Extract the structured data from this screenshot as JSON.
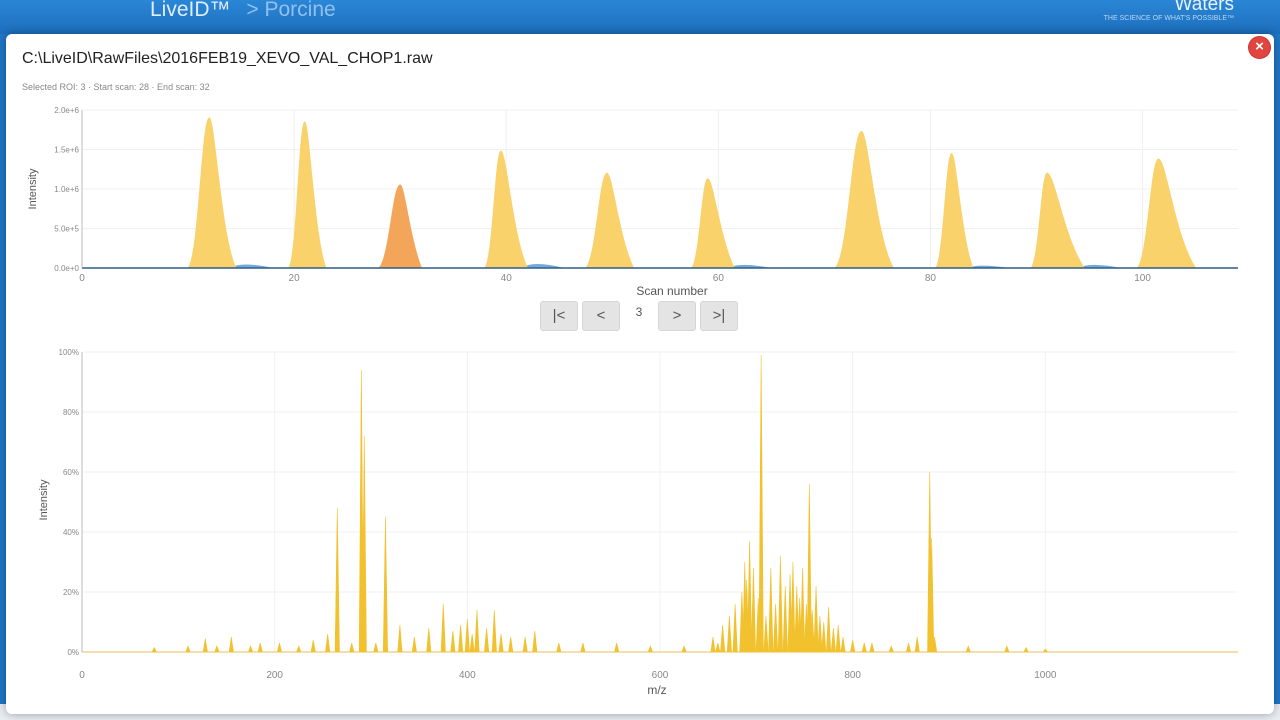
{
  "app": {
    "title": "LiveID™",
    "breadcrumb": "> Porcine",
    "brand": "Waters",
    "brand_sub": "THE SCIENCE OF WHAT'S POSSIBLE™"
  },
  "modal": {
    "file_path": "C:\\LiveID\\RawFiles\\2016FEB19_XEVO_VAL_CHOP1.raw",
    "selection_info": "Selected ROI: 3 · Start scan: 28 · End scan: 32",
    "close_label": "×"
  },
  "pager": {
    "first_label": "|<",
    "prev_label": "<",
    "value": "3",
    "next_label": ">",
    "last_label": ">|"
  },
  "colors": {
    "header": "#1f78c8",
    "peak": "#f9d26b",
    "selected_peak": "#f3a65a",
    "baseline": "#5b9bd5",
    "spectrum": "#f2c12e",
    "close": "#e0463f"
  },
  "chart_data": [
    {
      "type": "area",
      "xlabel": "Scan number",
      "ylabel": "Intensity",
      "xlim": [
        0,
        109
      ],
      "ylim": [
        0,
        2000000.0
      ],
      "x_ticks": [
        0,
        20,
        40,
        60,
        80,
        100
      ],
      "y_tick_labels": [
        "0.0e+0",
        "5.0e+5",
        "1.0e+6",
        "1.5e+6",
        "2.0e+6"
      ],
      "y_ticks": [
        0,
        500000,
        1000000,
        1500000,
        2000000
      ],
      "selected_roi": 3,
      "peaks": [
        {
          "roi": 1,
          "center": 12,
          "start": 10,
          "end": 14.5,
          "height": 1900000.0
        },
        {
          "roi": 2,
          "center": 21,
          "start": 19.5,
          "end": 23,
          "height": 1850000.0
        },
        {
          "roi": 3,
          "center": 30,
          "start": 28,
          "end": 32,
          "height": 1050000.0
        },
        {
          "roi": 4,
          "center": 39.5,
          "start": 38,
          "end": 42,
          "height": 1480000.0
        },
        {
          "roi": 5,
          "center": 49.5,
          "start": 47.5,
          "end": 52,
          "height": 1200000.0
        },
        {
          "roi": 6,
          "center": 59,
          "start": 57.5,
          "end": 61.5,
          "height": 1130000.0
        },
        {
          "roi": 7,
          "center": 73.5,
          "start": 71,
          "end": 76.5,
          "height": 1730000.0
        },
        {
          "roi": 8,
          "center": 82,
          "start": 80.5,
          "end": 84,
          "height": 1450000.0
        },
        {
          "roi": 9,
          "center": 91,
          "start": 89.5,
          "end": 94.5,
          "height": 1200000.0
        },
        {
          "roi": 10,
          "center": 101.5,
          "start": 99.5,
          "end": 105,
          "height": 1380000.0
        }
      ],
      "baseline_bumps": [
        {
          "x": 14.5,
          "height": 90000.0
        },
        {
          "x": 42,
          "height": 100000.0
        },
        {
          "x": 61.5,
          "height": 80000.0
        },
        {
          "x": 84,
          "height": 60000.0
        },
        {
          "x": 94.5,
          "height": 80000.0
        }
      ]
    },
    {
      "type": "line",
      "xlabel": "m/z",
      "ylabel": "Intensity",
      "xlim": [
        0,
        1200
      ],
      "ylim": [
        0,
        100
      ],
      "x_ticks": [
        0,
        200,
        400,
        600,
        800,
        1000
      ],
      "y_ticks": [
        0,
        20,
        40,
        60,
        80,
        100
      ],
      "y_tick_labels": [
        "0%",
        "20%",
        "40%",
        "60%",
        "80%",
        "100%"
      ],
      "peaks": [
        [
          75,
          1.5
        ],
        [
          110,
          2
        ],
        [
          128,
          4.5
        ],
        [
          140,
          2
        ],
        [
          155,
          5
        ],
        [
          175,
          2
        ],
        [
          185,
          3
        ],
        [
          205,
          3
        ],
        [
          225,
          2
        ],
        [
          240,
          4
        ],
        [
          255,
          6
        ],
        [
          265,
          48
        ],
        [
          280,
          3
        ],
        [
          290,
          94
        ],
        [
          293,
          72
        ],
        [
          305,
          3
        ],
        [
          315,
          45
        ],
        [
          330,
          9
        ],
        [
          345,
          5
        ],
        [
          360,
          8
        ],
        [
          375,
          16
        ],
        [
          385,
          7
        ],
        [
          393,
          9
        ],
        [
          400,
          11
        ],
        [
          405,
          6
        ],
        [
          410,
          14
        ],
        [
          420,
          8
        ],
        [
          428,
          14
        ],
        [
          435,
          6
        ],
        [
          445,
          5
        ],
        [
          460,
          5
        ],
        [
          470,
          7
        ],
        [
          495,
          3
        ],
        [
          520,
          3
        ],
        [
          555,
          3
        ],
        [
          590,
          2
        ],
        [
          625,
          2
        ],
        [
          655,
          5
        ],
        [
          660,
          3
        ],
        [
          665,
          9
        ],
        [
          672,
          12
        ],
        [
          678,
          16
        ],
        [
          685,
          20
        ],
        [
          688,
          30
        ],
        [
          690,
          24
        ],
        [
          693,
          37
        ],
        [
          697,
          28
        ],
        [
          702,
          18
        ],
        [
          705,
          99
        ],
        [
          710,
          12
        ],
        [
          715,
          28
        ],
        [
          720,
          16
        ],
        [
          725,
          32
        ],
        [
          730,
          22
        ],
        [
          735,
          26
        ],
        [
          738,
          30
        ],
        [
          742,
          22
        ],
        [
          745,
          18
        ],
        [
          748,
          28
        ],
        [
          752,
          16
        ],
        [
          755,
          56
        ],
        [
          758,
          14
        ],
        [
          762,
          22
        ],
        [
          766,
          12
        ],
        [
          770,
          10
        ],
        [
          775,
          15
        ],
        [
          780,
          8
        ],
        [
          785,
          9
        ],
        [
          790,
          5
        ],
        [
          800,
          4
        ],
        [
          812,
          3
        ],
        [
          820,
          3
        ],
        [
          840,
          2
        ],
        [
          858,
          3
        ],
        [
          867,
          5
        ],
        [
          880,
          60
        ],
        [
          882,
          38
        ],
        [
          885,
          5
        ],
        [
          920,
          2
        ],
        [
          960,
          2
        ],
        [
          980,
          1.5
        ],
        [
          1000,
          1
        ]
      ]
    }
  ]
}
